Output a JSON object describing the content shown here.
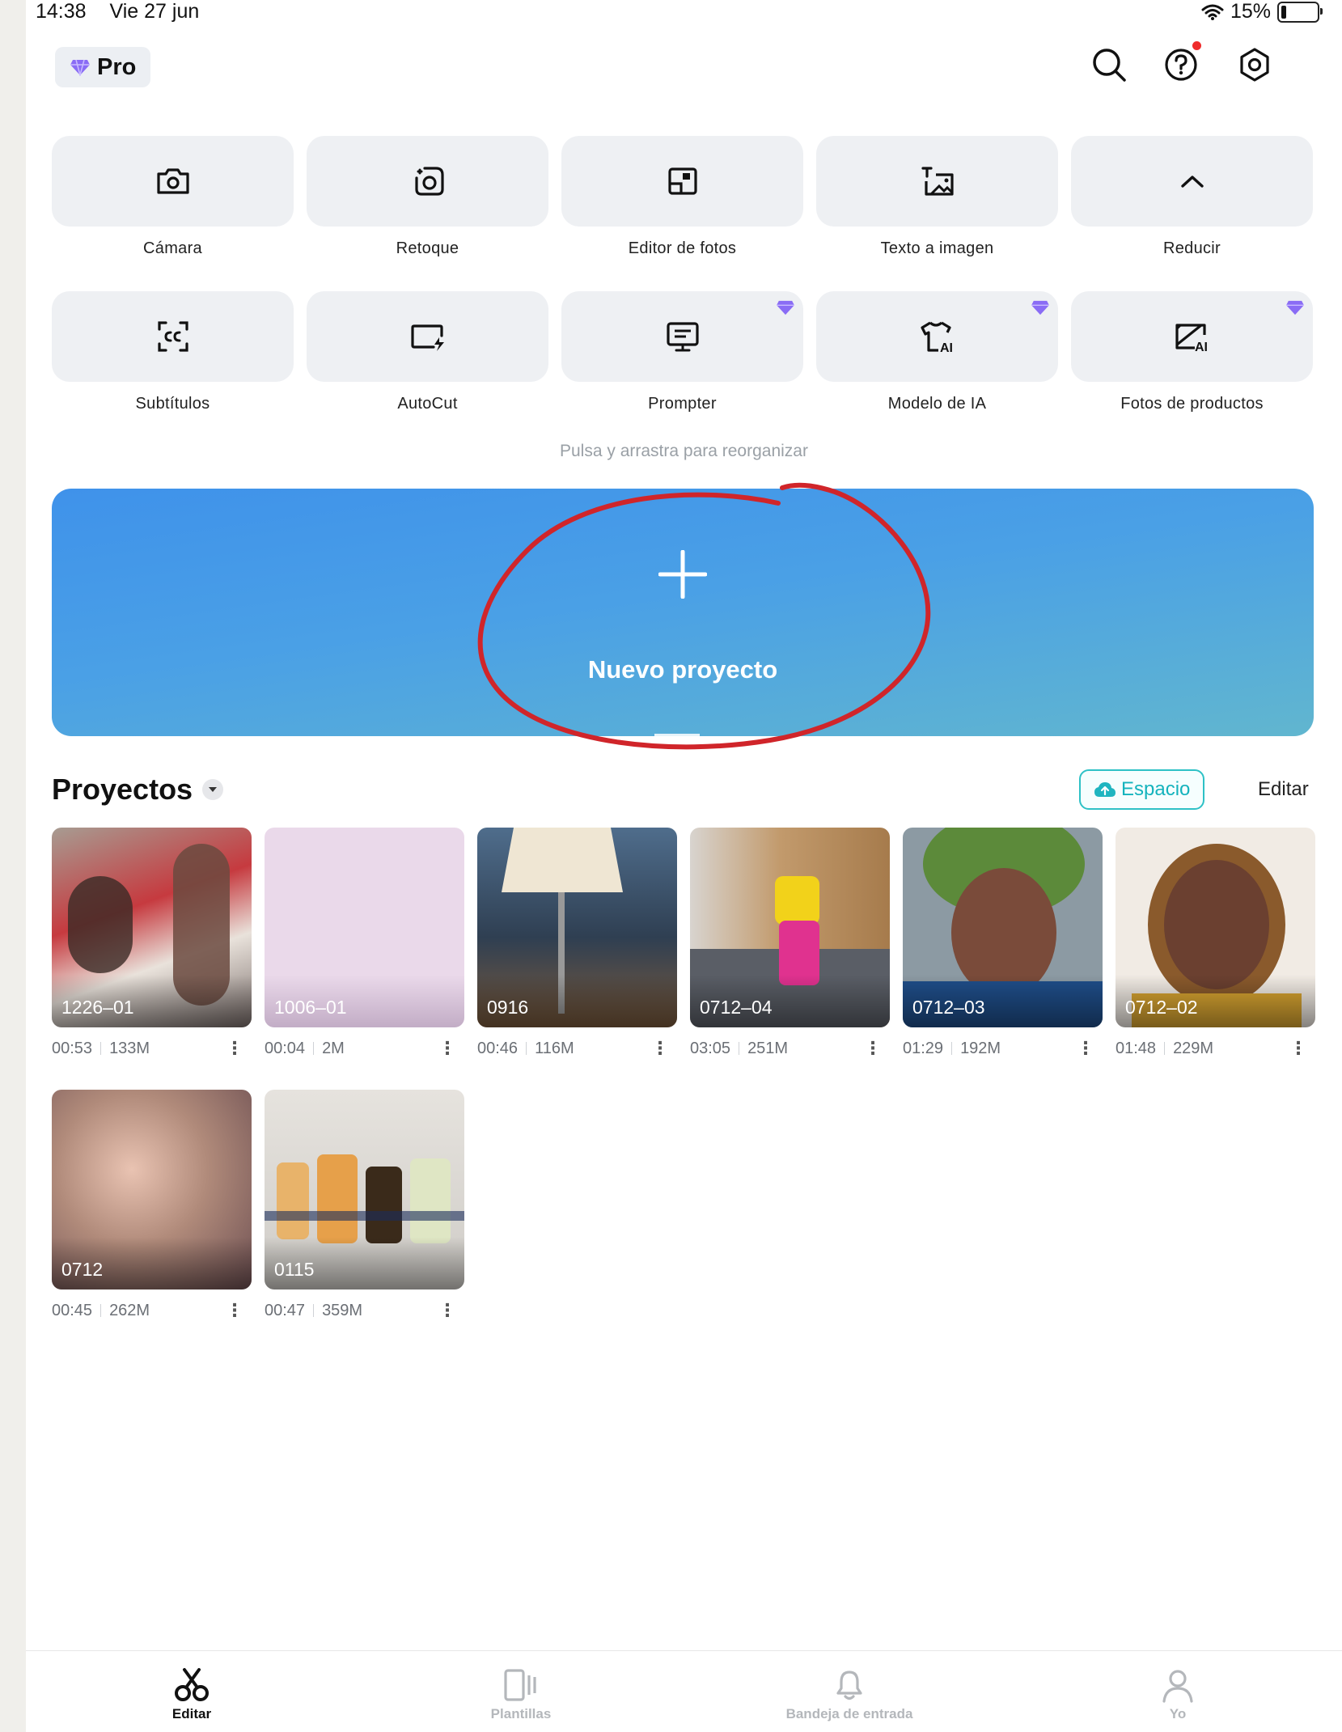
{
  "status_bar": {
    "time": "14:38",
    "date": "Vie 27 jun",
    "battery": "15%",
    "battery_level": 0.15
  },
  "header": {
    "pro_label": "Pro"
  },
  "tools": [
    {
      "label": "Cámara",
      "icon": "camera-icon",
      "premium": false
    },
    {
      "label": "Retoque",
      "icon": "retouch-icon",
      "premium": false
    },
    {
      "label": "Editor de fotos",
      "icon": "photo-editor-icon",
      "premium": false
    },
    {
      "label": "Texto a imagen",
      "icon": "text-to-image-icon",
      "premium": false
    },
    {
      "label": "Reducir",
      "icon": "chevron-up-icon",
      "premium": false
    },
    {
      "label": "Subtítulos",
      "icon": "captions-icon",
      "premium": false
    },
    {
      "label": "AutoCut",
      "icon": "autocut-icon",
      "premium": false
    },
    {
      "label": "Prompter",
      "icon": "prompter-icon",
      "premium": true
    },
    {
      "label": "Modelo de IA",
      "icon": "ai-model-icon",
      "premium": true
    },
    {
      "label": "Fotos de productos",
      "icon": "product-photo-icon",
      "premium": true
    }
  ],
  "hint": "Pulsa y arrastra para reorganizar",
  "new_project": {
    "label": "Nuevo proyecto"
  },
  "projects_section": {
    "title": "Proyectos",
    "space_label": "Espacio",
    "edit_label": "Editar"
  },
  "projects": [
    {
      "name": "1226–01",
      "duration": "00:53",
      "size": "133M"
    },
    {
      "name": "1006–01",
      "duration": "00:04",
      "size": "2M"
    },
    {
      "name": "0916",
      "duration": "00:46",
      "size": "116M"
    },
    {
      "name": "0712–04",
      "duration": "03:05",
      "size": "251M"
    },
    {
      "name": "0712–03",
      "duration": "01:29",
      "size": "192M"
    },
    {
      "name": "0712–02",
      "duration": "01:48",
      "size": "229M"
    },
    {
      "name": "0712",
      "duration": "00:45",
      "size": "262M"
    },
    {
      "name": "0115",
      "duration": "00:47",
      "size": "359M"
    }
  ],
  "bottom_nav": [
    {
      "label": "Editar",
      "icon": "scissors-icon",
      "active": true
    },
    {
      "label": "Plantillas",
      "icon": "templates-icon",
      "active": false
    },
    {
      "label": "Bandeja de entrada",
      "icon": "bell-icon",
      "active": false
    },
    {
      "label": "Yo",
      "icon": "profile-icon",
      "active": false
    }
  ],
  "colors": {
    "accent_teal": "#15b3bd",
    "premium_purple": "#8a6cf5",
    "notification_red": "#ef2b2b",
    "annotation_red": "#d0252a",
    "banner_start": "#3f92ea",
    "banner_end": "#61b6cf"
  }
}
